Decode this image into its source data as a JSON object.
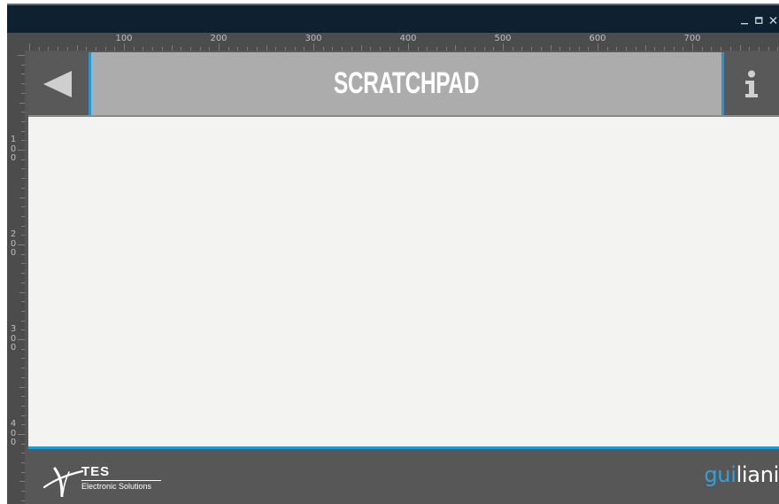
{
  "window": {
    "controls": {
      "minimize_icon": "minimize-icon",
      "maximize_icon": "maximize-icon",
      "close_icon": "close-icon"
    }
  },
  "ruler": {
    "horizontal_labels": [
      "100",
      "200",
      "300",
      "400",
      "500",
      "600",
      "700"
    ],
    "vertical_labels": [
      "1\n0\n0",
      "2\n0\n0",
      "3\n0\n0",
      "4\n0\n0"
    ]
  },
  "header": {
    "title": "SCRATCHPAD",
    "back_icon": "back-arrow-icon",
    "info_icon": "info-icon"
  },
  "footer": {
    "company_name": "TES",
    "company_tagline": "Electronic Solutions",
    "brand_part1": "gui",
    "brand_part2": "liani"
  },
  "colors": {
    "accent": "#1a9ad8",
    "titlebar": "#0d2131",
    "header_bg": "#595959",
    "title_bg": "#acacac",
    "canvas_bg": "#f3f3f1",
    "footer_bg": "#575757"
  }
}
